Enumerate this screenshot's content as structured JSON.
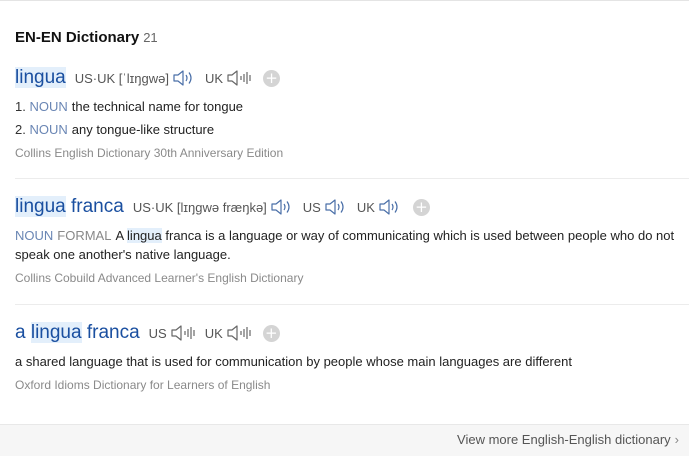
{
  "header": {
    "title": "EN-EN Dictionary",
    "count": "21"
  },
  "icons": {
    "speaker": "speaker-icon",
    "add": "plus-icon",
    "more": "chevron-right-icon"
  },
  "colors": {
    "headword": "#1a4fa0",
    "pos": "#6a86b4",
    "highlight": "#e3effb"
  },
  "entries": [
    {
      "word_hl": "lingua",
      "word_rest": "",
      "pron_prefix": "US·UK",
      "pron_ipa": "[ˈlɪŋɡwə]",
      "uk_label": "UK",
      "senses": [
        {
          "num": "1.",
          "pos": "NOUN",
          "text": "the technical name for tongue"
        },
        {
          "num": "2.",
          "pos": "NOUN",
          "text": "any tongue-like structure"
        }
      ],
      "source": "Collins English Dictionary 30th Anniversary Edition"
    },
    {
      "word_hl": "lingua",
      "word_rest": " franca",
      "pron_prefix": "US·UK",
      "pron_ipa": "[lɪŋɡwə fræŋkə]",
      "us_label": "US",
      "uk_label": "UK",
      "pos": "NOUN",
      "category": "FORMAL",
      "def_a": "A",
      "def_hl": "lingua",
      "def_rest": "franca is a language or way of communicating which is used between people who do not speak one another's native language.",
      "source": "Collins Cobuild Advanced Learner's English Dictionary"
    },
    {
      "word_pre": "a ",
      "word_hl": "lingua",
      "word_rest": " franca",
      "us_label": "US",
      "uk_label": "UK",
      "definition": "a shared language that is used for communication by people whose main languages are different",
      "source": "Oxford Idioms Dictionary for Learners of English"
    }
  ],
  "footer": {
    "more_label": "View more English-English dictionary",
    "chevron": "›"
  }
}
